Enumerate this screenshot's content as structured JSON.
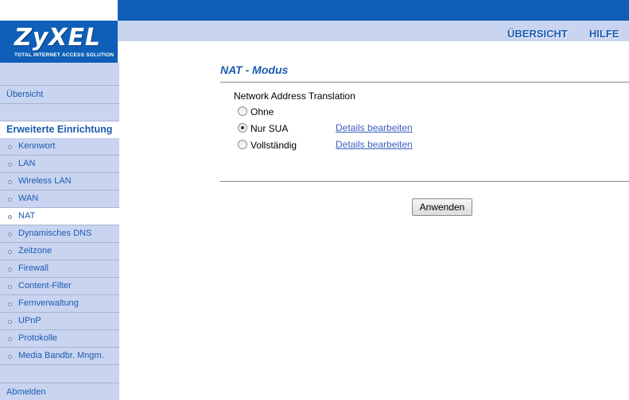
{
  "brand": {
    "logo": "ZyXEL",
    "tagline": "Total Internet Access Solution",
    "color": "#0f5fb8"
  },
  "header": {
    "links": [
      "ÜBERSICHT",
      "HILFE"
    ]
  },
  "sidebar": {
    "overview": "Übersicht",
    "section_title": "Erweiterte Einrichtung",
    "items": [
      {
        "label": "Kennwort",
        "active": false
      },
      {
        "label": "LAN",
        "active": false
      },
      {
        "label": "Wireless LAN",
        "active": false
      },
      {
        "label": "WAN",
        "active": false
      },
      {
        "label": "NAT",
        "active": true
      },
      {
        "label": "Dynamisches DNS",
        "active": false
      },
      {
        "label": "Zeitzone",
        "active": false
      },
      {
        "label": "Firewall",
        "active": false
      },
      {
        "label": "Content-Filter",
        "active": false
      },
      {
        "label": "Fernverwaltung",
        "active": false
      },
      {
        "label": "UPnP",
        "active": false
      },
      {
        "label": "Protokolle",
        "active": false
      },
      {
        "label": "Media Bandbr. Mngm.",
        "active": false
      }
    ],
    "logout": "Abmelden"
  },
  "main": {
    "title": "NAT - Modus",
    "section_label": "Network Address Translation",
    "options": [
      {
        "label": "Ohne",
        "checked": false,
        "link": ""
      },
      {
        "label": "Nur SUA",
        "checked": true,
        "link": "Details bearbeiten"
      },
      {
        "label": "Vollständig",
        "checked": false,
        "link": "Details bearbeiten"
      }
    ],
    "apply_label": "Anwenden"
  }
}
